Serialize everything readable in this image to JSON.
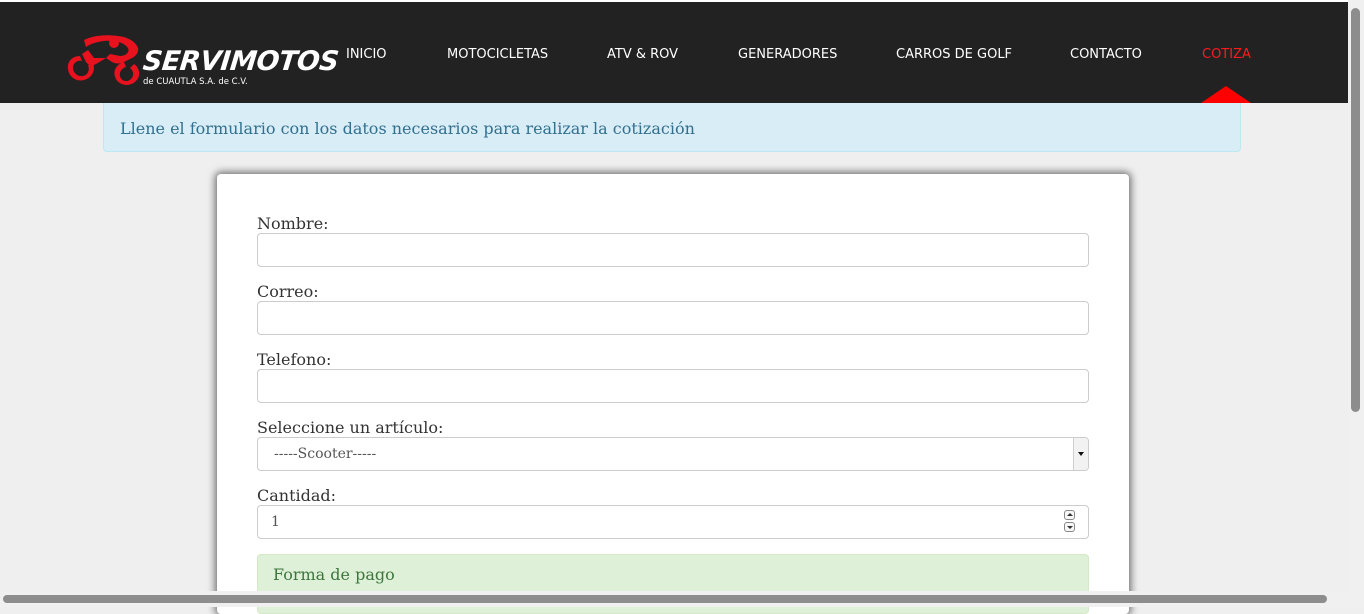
{
  "brand": {
    "name": "SERVIMOTOS",
    "subtitle": "de CUAUTLA S.A. de C.V.",
    "accent_color": "#e8121e"
  },
  "nav": {
    "items": [
      {
        "label": "INICIO",
        "active": false
      },
      {
        "label": "MOTOCICLETAS",
        "active": false
      },
      {
        "label": "ATV & ROV",
        "active": false
      },
      {
        "label": "GENERADORES",
        "active": false
      },
      {
        "label": "CARROS DE GOLF",
        "active": false
      },
      {
        "label": "CONTACTO",
        "active": false
      },
      {
        "label": "COTIZA",
        "active": true
      }
    ],
    "active_color": "#ff1b1b"
  },
  "info_alert": {
    "text": "Llene el formulario con los datos necesarios para realizar la cotización"
  },
  "form": {
    "name_label": "Nombre:",
    "name_value": "",
    "email_label": "Correo:",
    "email_value": "",
    "phone_label": "Telefono:",
    "phone_value": "",
    "article_label": "Seleccione un artículo:",
    "article_selected": "-----Scooter-----",
    "quantity_label": "Cantidad:",
    "quantity_value": "1"
  },
  "payment_alert": {
    "text": "Forma de pago"
  }
}
